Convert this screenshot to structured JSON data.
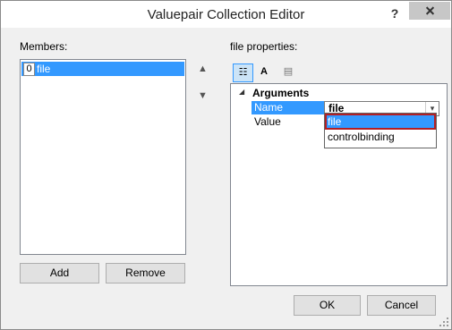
{
  "window": {
    "title": "Valuepair Collection Editor",
    "help_label": "?"
  },
  "members": {
    "label": "Members:",
    "items": [
      {
        "index": "0",
        "label": "file"
      }
    ],
    "move_up_glyph": "▲",
    "move_down_glyph": "▼"
  },
  "buttons": {
    "add": "Add",
    "remove": "Remove",
    "ok": "OK",
    "cancel": "Cancel"
  },
  "properties": {
    "label": "file properties:",
    "toolbar": {
      "categorized_icon": "categorized-icon",
      "alphabetical_icon": "alphabetical-icon",
      "property_pages_icon": "property-pages-icon",
      "alpha_glyph": "A Z↓",
      "cat_glyph": "☷",
      "pages_glyph": "▤"
    },
    "category": {
      "label": "Arguments",
      "toggle": "◢"
    },
    "rows": [
      {
        "name": "Name",
        "value": "file"
      },
      {
        "name": "Value",
        "value": ""
      }
    ],
    "combo_arrow": "▾",
    "dropdown_options": [
      "file",
      "controlbinding"
    ]
  },
  "colors": {
    "selection": "#3399ff",
    "highlight_border": "#b21f24"
  }
}
